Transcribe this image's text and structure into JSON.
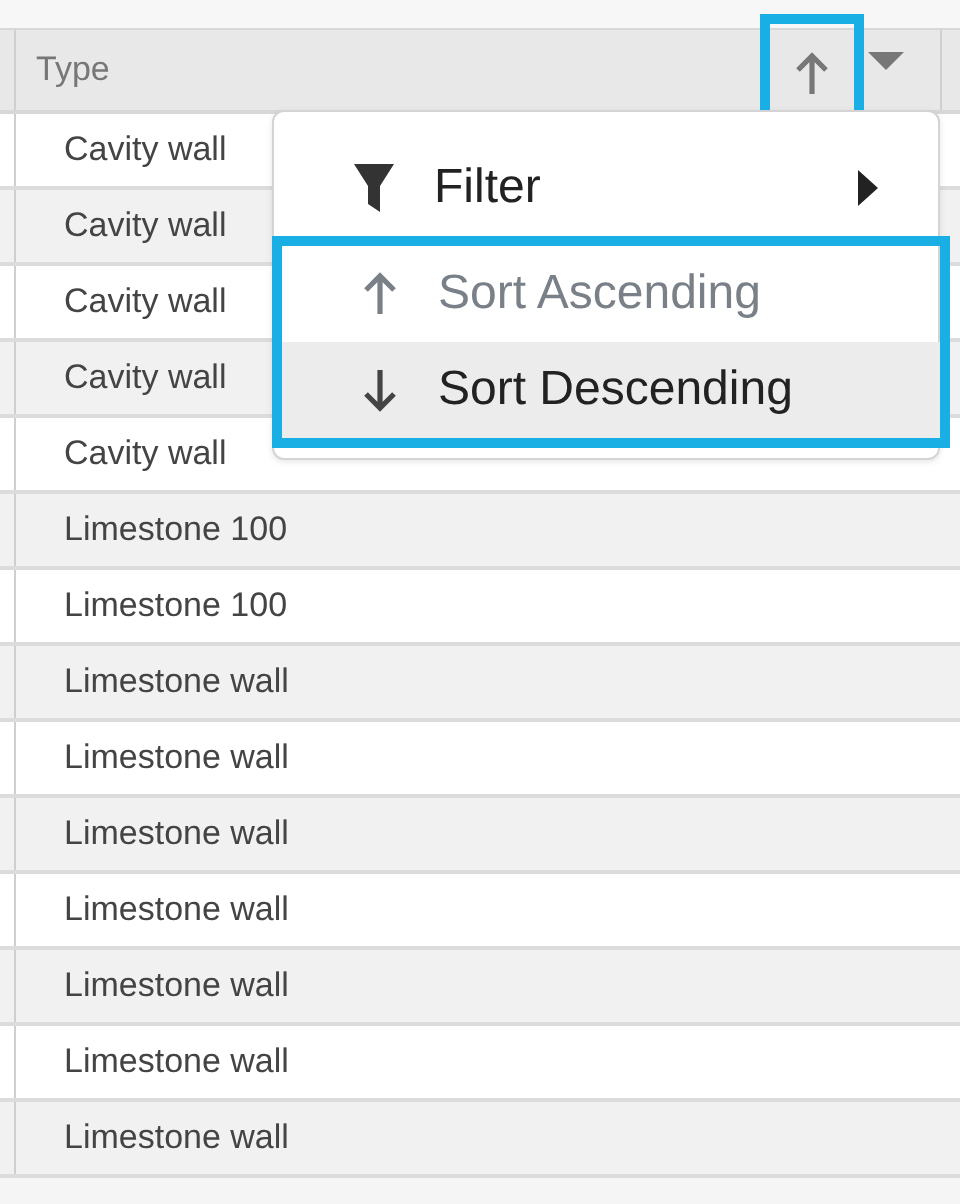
{
  "header": {
    "label": "Type",
    "sorted_ascending": true
  },
  "rows": [
    {
      "type": "Cavity wall"
    },
    {
      "type": "Cavity wall"
    },
    {
      "type": "Cavity wall"
    },
    {
      "type": "Cavity wall"
    },
    {
      "type": "Cavity wall"
    },
    {
      "type": "Limestone 100"
    },
    {
      "type": "Limestone 100"
    },
    {
      "type": "Limestone wall"
    },
    {
      "type": "Limestone wall"
    },
    {
      "type": "Limestone wall"
    },
    {
      "type": "Limestone wall"
    },
    {
      "type": "Limestone wall"
    },
    {
      "type": "Limestone wall"
    },
    {
      "type": "Limestone wall"
    }
  ],
  "menu": {
    "items": [
      {
        "kind": "filter",
        "label": "Filter",
        "disabled": false,
        "highlighted": false
      },
      {
        "kind": "sort-ascending",
        "label": "Sort Ascending",
        "disabled": true,
        "highlighted": false
      },
      {
        "kind": "sort-descending",
        "label": "Sort Descending",
        "disabled": false,
        "highlighted": true
      }
    ]
  }
}
